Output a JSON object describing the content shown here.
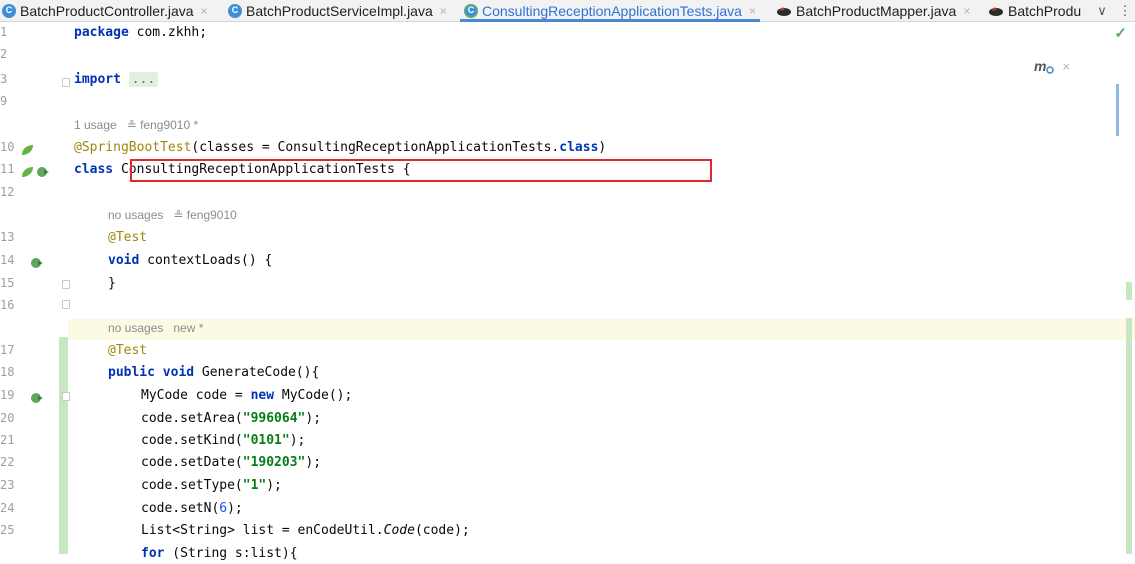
{
  "tabs": [
    {
      "label": "BatchProductController.java",
      "icon": "class-icon",
      "active": false
    },
    {
      "label": "BatchProductServiceImpl.java",
      "icon": "class-icon",
      "active": false
    },
    {
      "label": "ConsultingReceptionApplicationTests.java",
      "icon": "test-class-icon",
      "active": true
    },
    {
      "label": "BatchProductMapper.java",
      "icon": "mapper-icon",
      "active": false
    },
    {
      "label": "BatchProdu",
      "icon": "mapper-icon",
      "active": false
    }
  ],
  "tab_close_glyph": "×",
  "tab_overflow_glyph": "∨",
  "tab_menu_glyph": "⋮",
  "inspection_status_glyph": "✓",
  "popup": {
    "icon_label": "m",
    "close_glyph": "×"
  },
  "line_numbers": [
    "1",
    "2",
    "3",
    "9",
    "10",
    "11",
    "12",
    "13",
    "14",
    "15",
    "16",
    "17",
    "18",
    "19",
    "20",
    "21",
    "22",
    "23",
    "24",
    "25"
  ],
  "code": {
    "package_kw": "package",
    "package_name": " com.zkhh;",
    "import_kw": "import",
    "import_fold": "...",
    "hint1": "1 usage   ≗ feng9010 *",
    "annotation_sb": "@SpringBootTest",
    "annotation_sb_args": "(classes = ConsultingReceptionApplicationTests.",
    "class_kw_inline": "class",
    "annotation_sb_close": ")",
    "class_kw": "class",
    "class_decl": " ConsultingReceptionApplicationTests {",
    "hint2": "no usages   ≗ feng9010",
    "test_ann_1": "@Test",
    "void_kw": "void",
    "context_loads": " contextLoads() {",
    "close_brace": "}",
    "hint3": "no usages   new *",
    "test_ann_2": "@Test",
    "public_kw": "public",
    "void_kw_2": " void",
    "generate_code": " GenerateCode(){",
    "mycode_1": "MyCode code = ",
    "new_kw": "new",
    "mycode_2": " MyCode();",
    "set_area_1": "code.setArea(",
    "set_area_val": "\"996064\"",
    "set_kind_1": "code.setKind(",
    "set_kind_val": "\"0101\"",
    "set_date_1": "code.setDate(",
    "set_date_val": "\"190203\"",
    "set_type_1": "code.setType(",
    "set_type_val": "\"1\"",
    "set_n_1": "code.setN(",
    "set_n_val": "6",
    "stmt_end": ");",
    "list_1": "List<String> list = enCodeUtil.",
    "list_method": "Code",
    "list_2": "(code);",
    "for_kw": "for",
    "for_rest": " (String s:list){"
  },
  "colors": {
    "keyword": "#0033b3",
    "annotation": "#9e880d",
    "string": "#067d17",
    "number": "#1750eb",
    "highlight_box": "#e1282c",
    "active_tab": "#2f72d6"
  }
}
